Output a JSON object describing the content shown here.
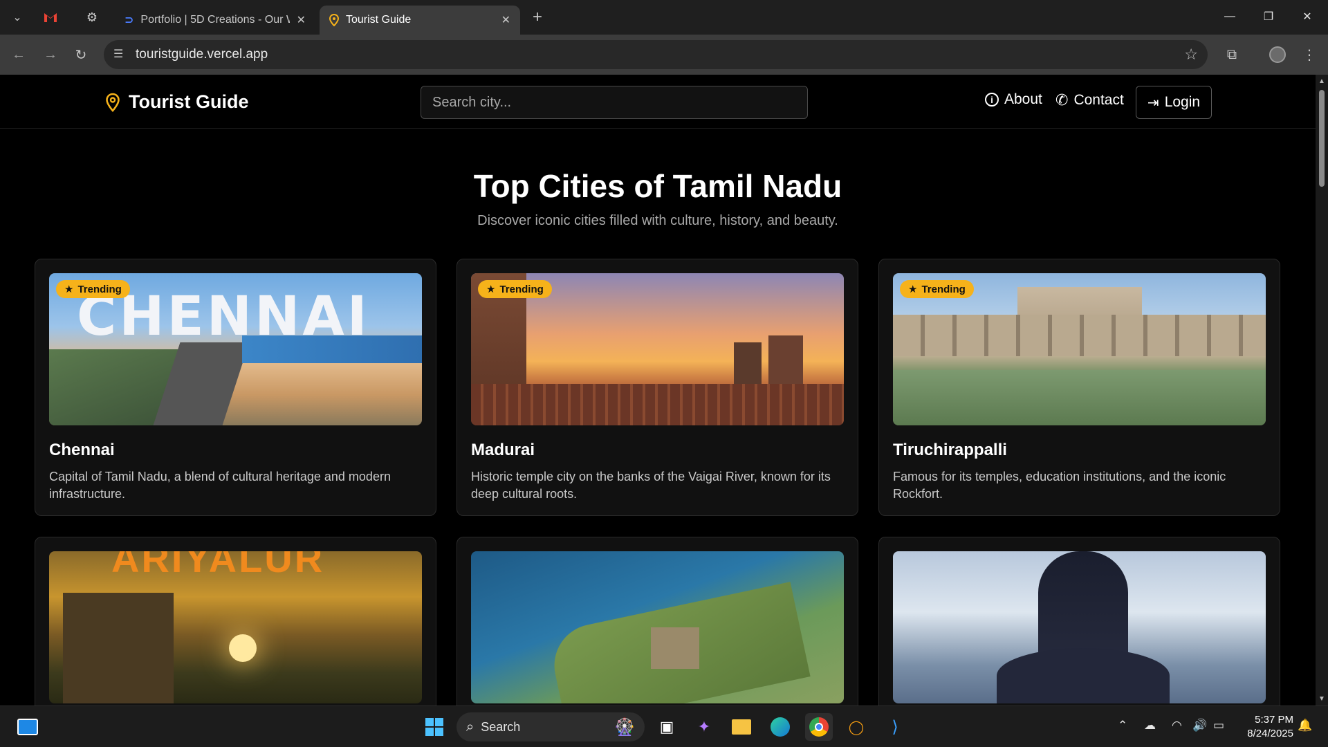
{
  "browser": {
    "tabs": [
      {
        "label": "",
        "icon": "gmail-icon"
      },
      {
        "label": "",
        "icon": "gear-icon"
      },
      {
        "label": "Portfolio | 5D Creations - Our W",
        "icon": "portfolio-icon"
      },
      {
        "label": "Tourist Guide",
        "icon": "location-pin-icon",
        "active": true
      }
    ],
    "url": "touristguide.vercel.app"
  },
  "site": {
    "brand": "Tourist Guide",
    "search_placeholder": "Search city...",
    "nav": {
      "about": "About",
      "contact": "Contact",
      "login": "Login"
    },
    "accent_color": "#f6b21a"
  },
  "hero": {
    "title": "Top Cities of Tamil Nadu",
    "subtitle": "Discover iconic cities filled with culture, history, and beauty."
  },
  "cities": [
    {
      "name": "Chennai",
      "description": "Capital of Tamil Nadu, a blend of cultural heritage and modern infrastructure.",
      "badge": "Trending",
      "image_text": "CHENNAI"
    },
    {
      "name": "Madurai",
      "description": "Historic temple city on the banks of the Vaigai River, known for its deep cultural roots.",
      "badge": "Trending"
    },
    {
      "name": "Tiruchirappalli",
      "description": "Famous for its temples, education institutions, and the iconic Rockfort.",
      "badge": "Trending"
    },
    {
      "image_text": "ARIYALUR"
    },
    {},
    {}
  ],
  "taskbar": {
    "search_label": "Search",
    "time": "5:37 PM",
    "date": "8/24/2025"
  }
}
